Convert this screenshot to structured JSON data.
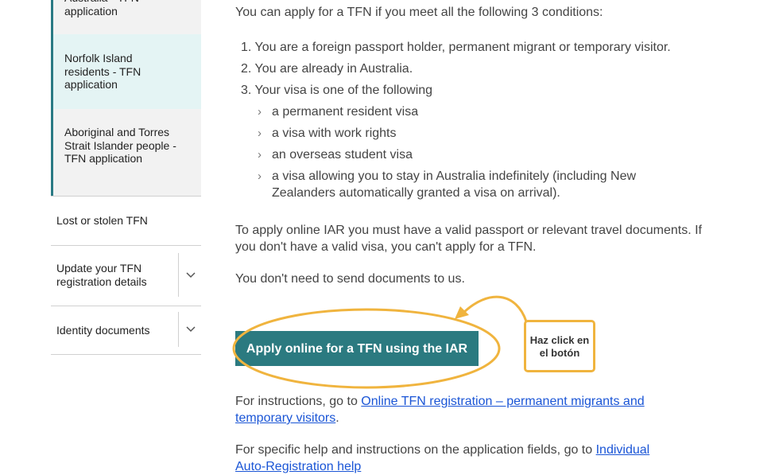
{
  "sidebar": {
    "sub_items": [
      {
        "label": "Australia - TFN application"
      },
      {
        "label": "Norfolk Island residents - TFN application"
      },
      {
        "label": "Aboriginal and Torres Strait Islander people - TFN application"
      }
    ],
    "lost_stolen": "Lost or stolen TFN",
    "update_details": "Update your TFN registration details",
    "identity_documents": "Identity documents"
  },
  "main": {
    "intro": "You can apply for a TFN if you meet all the following 3  conditions:",
    "conditions": [
      "You are a foreign passport holder, permanent migrant or temporary visitor.",
      "You are already in Australia.",
      "Your visa is one of the following"
    ],
    "visa_types": [
      "a permanent resident visa",
      "a visa with work rights",
      "an overseas student visa",
      "a visa allowing you to stay in Australia indefinitely (including New Zealanders automatically granted a visa on arrival)."
    ],
    "iar_requirement": "To apply online IAR you must have a valid passport or relevant travel documents. If you don't have a valid visa, you can't apply for a TFN.",
    "no_documents": "You don't need to send documents to us.",
    "apply_button": "Apply online for a TFN using the IAR",
    "instructions_prefix": "For instructions, go to ",
    "instructions_link": "Online TFN registration – permanent migrants and temporary visitors",
    "instructions_suffix": ".",
    "help_prefix": "For specific help and instructions on the application fields, go to ",
    "help_link": "Individual Auto-Registration help"
  },
  "annotation": {
    "callout_text_line1": "Haz click en",
    "callout_text_line2": "el botón",
    "color": "#f0b43e"
  },
  "colors": {
    "accent": "#2b7a80",
    "link": "#1a55d6",
    "sidebar_active_bg": "#e4f4f4",
    "sidebar_bg": "#f2f2f2"
  }
}
